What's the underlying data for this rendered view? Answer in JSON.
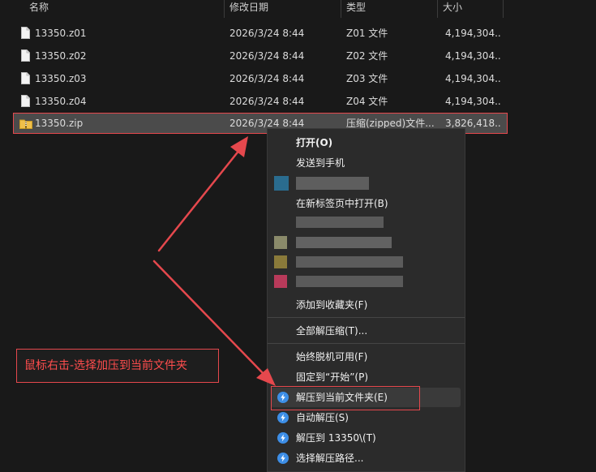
{
  "columns": [
    "名称",
    "修改日期",
    "类型",
    "大小"
  ],
  "files": [
    {
      "name": "13350.z01",
      "date": "2026/3/24 8:44",
      "type": "Z01 文件",
      "size": "4,194,304...",
      "icon": "file-icon"
    },
    {
      "name": "13350.z02",
      "date": "2026/3/24 8:44",
      "type": "Z02 文件",
      "size": "4,194,304...",
      "icon": "file-icon"
    },
    {
      "name": "13350.z03",
      "date": "2026/3/24 8:44",
      "type": "Z03 文件",
      "size": "4,194,304...",
      "icon": "file-icon"
    },
    {
      "name": "13350.z04",
      "date": "2026/3/24 8:44",
      "type": "Z04 文件",
      "size": "4,194,304...",
      "icon": "file-icon"
    },
    {
      "name": "13350.zip",
      "date": "2026/3/24 8:44",
      "type": "压缩(zipped)文件...",
      "size": "3,826,418...",
      "icon": "zip-folder-icon",
      "selected": true
    }
  ],
  "context_menu": {
    "open": "打开(O)",
    "send_to_phone": "发送到手机",
    "open_new_tab": "在新标签页中打开(B)",
    "add_favorites": "添加到收藏夹(F)",
    "extract_all": "全部解压缩(T)...",
    "always_offline": "始终脱机可用(F)",
    "pin_start": "固定到“开始”(P)",
    "extract_here": "解压到当前文件夹(E)",
    "auto_extract": "自动解压(S)",
    "extract_to_folder": "解压到 13350\\(T)",
    "choose_path": "选择解压路径..."
  },
  "annotation": {
    "label": "鼠标右击-选择加压到当前文件夹",
    "color": "#e5484d"
  },
  "colors": {
    "background": "#191919",
    "menu_bg": "#2b2b2b",
    "selected_row": "#4b4b4b",
    "accent_blue": "#3d8ee6",
    "annotation_red": "#e5484d"
  }
}
